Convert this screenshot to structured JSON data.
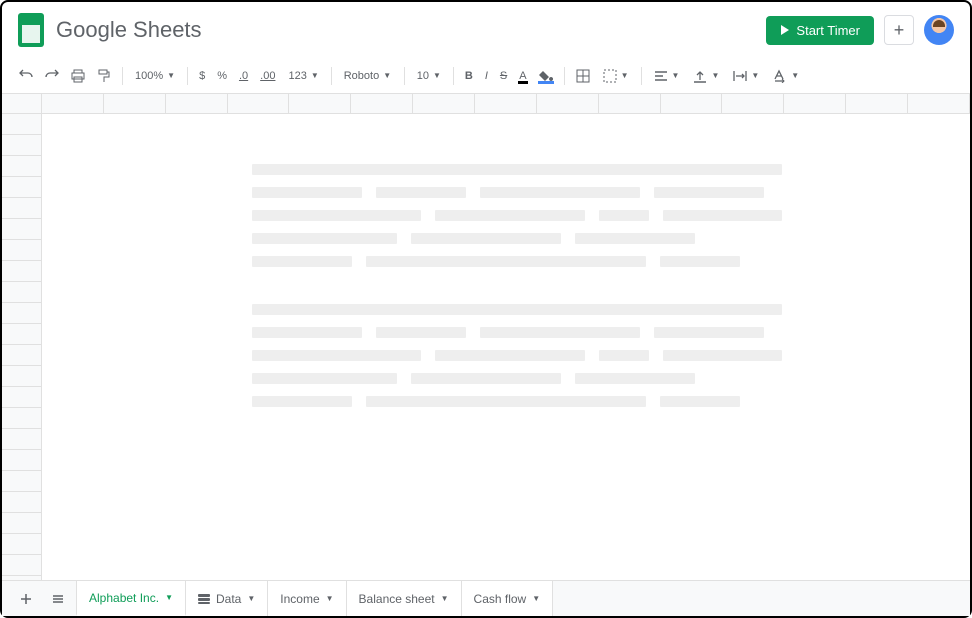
{
  "header": {
    "app_title": "Google Sheets",
    "start_timer_label": "Start Timer"
  },
  "toolbar": {
    "zoom": "100%",
    "currency": "$",
    "percent": "%",
    "dec_decrease": ".0",
    "dec_increase": ".00",
    "more_formats": "123",
    "font": "Roboto",
    "font_size": "10",
    "bold": "B",
    "italic": "I",
    "strike": "S",
    "text_color": "A"
  },
  "tabs": {
    "items": [
      {
        "label": "Alphabet Inc.",
        "active": true,
        "icon": null
      },
      {
        "label": "Data",
        "active": false,
        "icon": "stack"
      },
      {
        "label": "Income",
        "active": false,
        "icon": null
      },
      {
        "label": "Balance sheet",
        "active": false,
        "icon": null
      },
      {
        "label": "Cash flow",
        "active": false,
        "icon": null
      }
    ]
  }
}
